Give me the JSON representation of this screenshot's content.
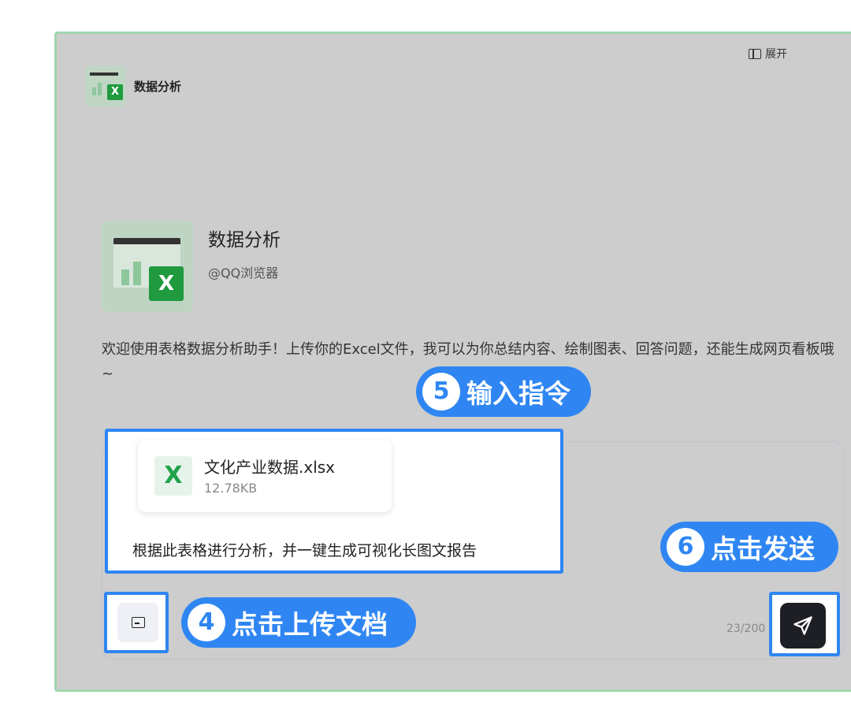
{
  "header": {
    "app_title": "数据分析",
    "expand_label": "展开"
  },
  "agent": {
    "name": "数据分析",
    "author": "@QQ浏览器",
    "logo_badge": "X"
  },
  "welcome_text": "欢迎使用表格数据分析助手！上传你的Excel文件，我可以为你总结内容、绘制图表、回答问题，还能生成网页看板哦 ~",
  "composer": {
    "file": {
      "icon_letter": "X",
      "name": "文化产业数据.xlsx",
      "size": "12.78KB"
    },
    "prompt": "根据此表格进行分析，并一键生成可视化长图文报告",
    "counter": "23/200"
  },
  "callouts": {
    "c5": {
      "num": "5",
      "label": "输入指令"
    },
    "c6": {
      "num": "6",
      "label": "点击发送"
    },
    "c4": {
      "num": "4",
      "label": "点击上传文档"
    }
  },
  "colors": {
    "accent": "#2f86f2",
    "frame_border": "#9fd5ae",
    "excel_green": "#1f9a3f"
  }
}
